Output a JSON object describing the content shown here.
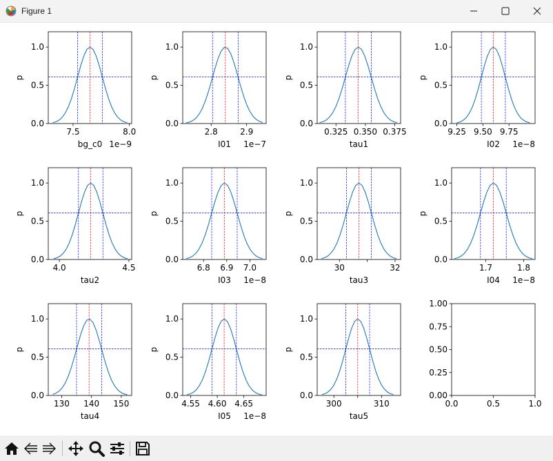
{
  "window": {
    "title": "Figure 1"
  },
  "window_controls": {
    "minimize": "minimize",
    "maximize": "maximize",
    "close": "close"
  },
  "toolbar": {
    "items": [
      {
        "name": "home-icon"
      },
      {
        "name": "back-icon"
      },
      {
        "name": "forward-icon"
      },
      {
        "name": "pan-icon"
      },
      {
        "name": "zoom-icon"
      },
      {
        "name": "subplots-icon"
      },
      {
        "name": "save-icon"
      }
    ]
  },
  "colors": {
    "curve": "#1f77b4",
    "central_line": "#ff0000",
    "interval_line": "#0000ff"
  },
  "chart_data": [
    {
      "type": "line",
      "xlabel": "bg_c0",
      "ylabel": "p",
      "offset": "1e−9",
      "xlim": [
        7.28,
        8.02
      ],
      "ylim": [
        0,
        1.2
      ],
      "xticks": [
        7.5,
        8.0
      ],
      "xticklabels": [
        "7.5",
        "8.0"
      ],
      "yticks": [
        0,
        0.5,
        1
      ],
      "yticklabels": [
        "0.0",
        "0.5",
        "1.0"
      ],
      "x_start": 7.32,
      "x_end": 7.98,
      "center": 7.65,
      "sigma": 0.11,
      "lower": 7.54,
      "upper": 7.76,
      "hline": 0.61
    },
    {
      "type": "line",
      "xlabel": "I01",
      "ylabel": "p",
      "offset": "1e−7",
      "xlim": [
        2.72,
        2.955
      ],
      "ylim": [
        0,
        1.2
      ],
      "xticks": [
        2.8,
        2.9
      ],
      "xticklabels": [
        "2.8",
        "2.9"
      ],
      "yticks": [
        0,
        0.5,
        1
      ],
      "yticklabels": [
        "0.0",
        "0.5",
        "1.0"
      ],
      "x_start": 2.73,
      "x_end": 2.945,
      "center": 2.84,
      "sigma": 0.036,
      "lower": 2.804,
      "upper": 2.876,
      "hline": 0.61
    },
    {
      "type": "line",
      "xlabel": "tau1",
      "ylabel": "p",
      "offset": "",
      "xlim": [
        0.309,
        0.38
      ],
      "ylim": [
        0,
        1.2
      ],
      "xticks": [
        0.325,
        0.35,
        0.375
      ],
      "xticklabels": [
        "0.325",
        "0.350",
        "0.375"
      ],
      "yticks": [
        0,
        0.5,
        1
      ],
      "yticklabels": [
        "0.0",
        "0.5",
        "1.0"
      ],
      "x_start": 0.311,
      "x_end": 0.377,
      "center": 0.344,
      "sigma": 0.011,
      "lower": 0.333,
      "upper": 0.355,
      "hline": 0.61
    },
    {
      "type": "line",
      "xlabel": "I02",
      "ylabel": "p",
      "offset": "1e−8",
      "xlim": [
        9.2,
        10.0
      ],
      "ylim": [
        0,
        1.2
      ],
      "xticks": [
        9.25,
        9.5,
        9.75
      ],
      "xticklabels": [
        "9.25",
        "9.50",
        "9.75"
      ],
      "yticks": [
        0,
        0.5,
        1
      ],
      "yticklabels": [
        "0.0",
        "0.5",
        "1.0"
      ],
      "x_start": 9.25,
      "x_end": 9.95,
      "center": 9.6,
      "sigma": 0.115,
      "lower": 9.485,
      "upper": 9.715,
      "hline": 0.61
    },
    {
      "type": "line",
      "xlabel": "tau2",
      "ylabel": "p",
      "offset": "",
      "xlim": [
        3.92,
        4.52
      ],
      "ylim": [
        0,
        1.2
      ],
      "xticks": [
        4.0,
        4.5
      ],
      "xticklabels": [
        "4.0",
        "4.5"
      ],
      "yticks": [
        0,
        0.5,
        1
      ],
      "yticklabels": [
        "0.0",
        "0.5",
        "1.0"
      ],
      "x_start": 3.96,
      "x_end": 4.49,
      "center": 4.225,
      "sigma": 0.088,
      "lower": 4.137,
      "upper": 4.313,
      "hline": 0.61
    },
    {
      "type": "line",
      "xlabel": "I03",
      "ylabel": "p",
      "offset": "1e−8",
      "xlim": [
        6.71,
        7.07
      ],
      "ylim": [
        0,
        1.2
      ],
      "xticks": [
        6.8,
        6.9,
        7.0
      ],
      "xticklabels": [
        "6.8",
        "6.9",
        "7.0"
      ],
      "yticks": [
        0,
        0.5,
        1
      ],
      "yticklabels": [
        "0.0",
        "0.5",
        "1.0"
      ],
      "x_start": 6.725,
      "x_end": 7.055,
      "center": 6.89,
      "sigma": 0.055,
      "lower": 6.835,
      "upper": 6.945,
      "hline": 0.61
    },
    {
      "type": "line",
      "xlabel": "tau3",
      "ylabel": "p",
      "offset": "",
      "xlim": [
        29.2,
        32.2
      ],
      "ylim": [
        0,
        1.2
      ],
      "xticks": [
        30,
        31,
        32
      ],
      "xticklabels": [
        "30",
        "",
        "32"
      ],
      "yticks": [
        0,
        0.5,
        1
      ],
      "yticklabels": [
        "0.0",
        "0.5",
        "1.0"
      ],
      "x_start": 29.35,
      "x_end": 32.05,
      "center": 30.7,
      "sigma": 0.45,
      "lower": 30.25,
      "upper": 31.15,
      "hline": 0.61
    },
    {
      "type": "line",
      "xlabel": "I04",
      "ylabel": "p",
      "offset": "1e−8",
      "xlim": [
        1.61,
        1.83
      ],
      "ylim": [
        0,
        1.2
      ],
      "xticks": [
        1.7,
        1.8
      ],
      "xticklabels": [
        "1.7",
        "1.8"
      ],
      "yticks": [
        0,
        0.5,
        1
      ],
      "yticklabels": [
        "0.0",
        "0.5",
        "1.0"
      ],
      "x_start": 1.617,
      "x_end": 1.823,
      "center": 1.72,
      "sigma": 0.034,
      "lower": 1.686,
      "upper": 1.754,
      "hline": 0.61
    },
    {
      "type": "line",
      "xlabel": "tau4",
      "ylabel": "p",
      "offset": "",
      "xlim": [
        125.5,
        153.5
      ],
      "ylim": [
        0,
        1.2
      ],
      "xticks": [
        130,
        140,
        150
      ],
      "xticklabels": [
        "130",
        "140",
        "150"
      ],
      "yticks": [
        0,
        0.5,
        1
      ],
      "yticklabels": [
        "0.0",
        "0.5",
        "1.0"
      ],
      "x_start": 127,
      "x_end": 152,
      "center": 139.2,
      "sigma": 4.2,
      "lower": 135.0,
      "upper": 143.4,
      "hline": 0.61
    },
    {
      "type": "line",
      "xlabel": "I05",
      "ylabel": "p",
      "offset": "1e−8",
      "xlim": [
        4.535,
        4.692
      ],
      "ylim": [
        0,
        1.2
      ],
      "xticks": [
        4.55,
        4.6,
        4.65
      ],
      "xticklabels": [
        "4.55",
        "4.60",
        "4.65"
      ],
      "yticks": [
        0,
        0.5,
        1
      ],
      "yticklabels": [
        "0.0",
        "0.5",
        "1.0"
      ],
      "x_start": 4.543,
      "x_end": 4.684,
      "center": 4.613,
      "sigma": 0.023,
      "lower": 4.59,
      "upper": 4.636,
      "hline": 0.61
    },
    {
      "type": "line",
      "xlabel": "tau5",
      "ylabel": "p",
      "offset": "",
      "xlim": [
        296.5,
        314
      ],
      "ylim": [
        0,
        1.2
      ],
      "xticks": [
        300,
        305,
        310
      ],
      "xticklabels": [
        "300",
        "",
        "310"
      ],
      "yticks": [
        0,
        0.5,
        1
      ],
      "yticklabels": [
        "0.0",
        "0.5",
        "1.0"
      ],
      "x_start": 297.5,
      "x_end": 312.5,
      "center": 305,
      "sigma": 2.5,
      "lower": 302.5,
      "upper": 307.5,
      "hline": 0.61
    },
    {
      "type": "empty",
      "xlabel": "",
      "ylabel": "",
      "offset": "",
      "xlim": [
        0,
        1
      ],
      "ylim": [
        0,
        1
      ],
      "xticks": [
        0,
        0.5,
        1
      ],
      "xticklabels": [
        "0.0",
        "0.5",
        "1.0"
      ],
      "yticks": [
        0,
        0.25,
        0.5,
        0.75,
        1
      ],
      "yticklabels": [
        "0.00",
        "0.25",
        "0.50",
        "0.75",
        "1.00"
      ]
    }
  ]
}
